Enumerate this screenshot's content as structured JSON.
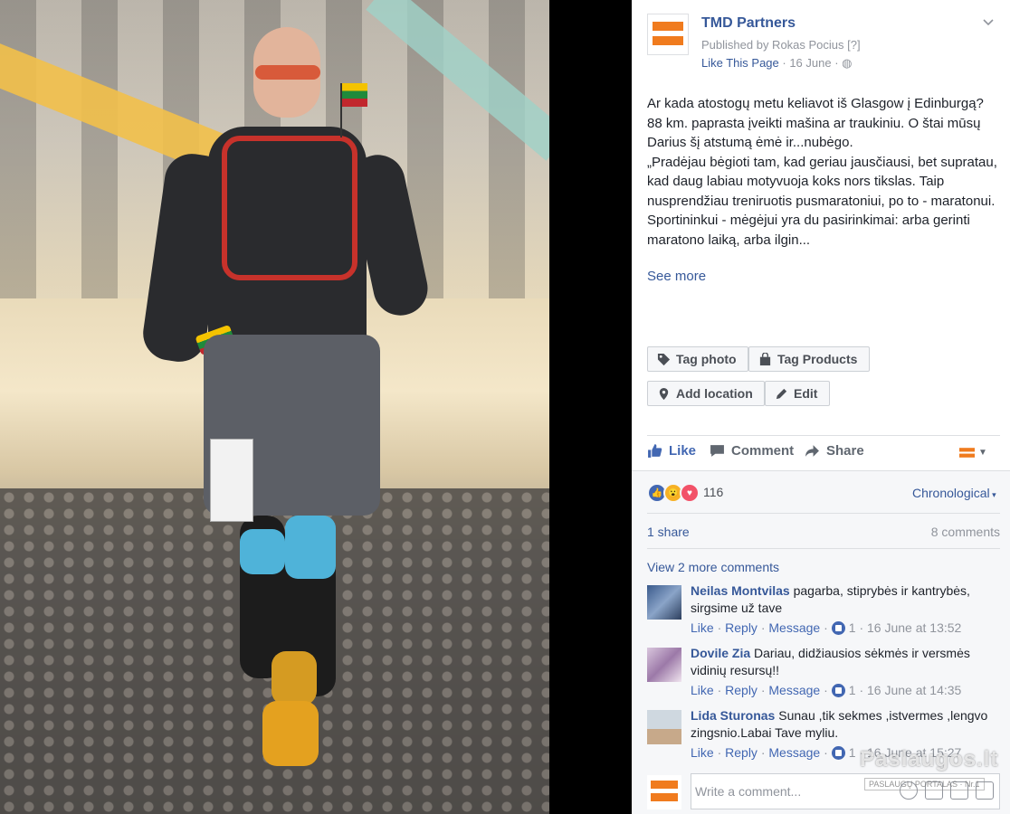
{
  "post": {
    "page_name": "TMD Partners",
    "published_by": "Published by Rokas Pocius [?]",
    "like_page": "Like This Page",
    "date_line": " · 16 June · ",
    "text": "Ar kada atostogų metu keliavot iš Glasgow į Edinburgą? 88 km. paprasta įveikti mašina ar traukiniu. O štai mūsų Darius šį atstumą ėmė ir...nubėgo.\n„Pradėjau bėgioti tam, kad geriau jausčiausi, bet supratau, kad daug labiau motyvuoja koks nors tikslas. Taip nusprendžiau treniruotis pusmaratoniui, po to - maratonui. Sportininkui - mėgėjui yra du pasirinkimai: arba gerinti maratono laiką, arba ilgin...",
    "see_more": "See more"
  },
  "photo_buttons": {
    "tag_photo": "Tag photo",
    "tag_products": "Tag Products",
    "add_location": "Add location",
    "edit": "Edit"
  },
  "actions": {
    "like": "Like",
    "comment": "Comment",
    "share": "Share"
  },
  "stats": {
    "reactions_count": "116",
    "sort": "Chronological",
    "shares": "1 share",
    "comments": "8 comments",
    "view_more": "View 2 more comments"
  },
  "comments": [
    {
      "name": "Neilas Montvilas",
      "text": " pagarba, stiprybės ir kantrybės, sirgsime už tave",
      "like": "Like",
      "reply": "Reply",
      "message": "Message",
      "likes": "1",
      "time": "16 June at 13:52"
    },
    {
      "name": "Dovile Zia",
      "text": " Dariau, didžiausios sėkmės ir versmės vidinių resursų!!",
      "like": "Like",
      "reply": "Reply",
      "message": "Message",
      "likes": "1",
      "time": "16 June at 14:35"
    },
    {
      "name": "Lida Sturonas",
      "text": " Sunau ,tik sekmes ,istvermes ,lengvo zingsnio.Labai Tave myliu.",
      "like": "Like",
      "reply": "Reply",
      "message": "Message",
      "likes": "1",
      "time": "16 June at 15:27"
    }
  ],
  "composer": {
    "placeholder": "Write a comment..."
  },
  "watermark": {
    "brand": "Paslaugos.lt",
    "sub": "PASLAUGŲ PORTALAS · Nr.1"
  },
  "colors": {
    "brand_orange": "#f07b1e",
    "fb_blue": "#4267b2",
    "link_blue": "#365899"
  }
}
